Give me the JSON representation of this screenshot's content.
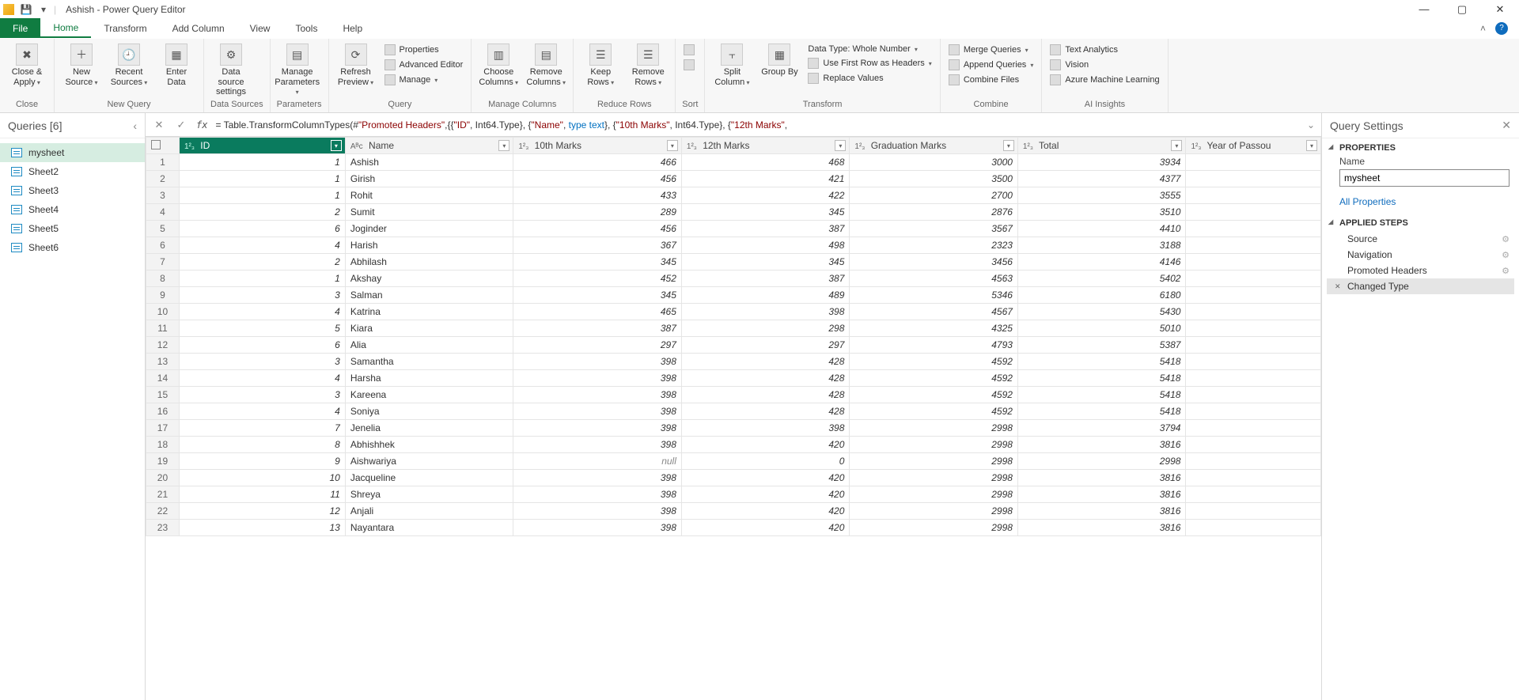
{
  "title": "Ashish - Power Query Editor",
  "menu": {
    "file": "File",
    "home": "Home",
    "transform": "Transform",
    "addcolumn": "Add Column",
    "view": "View",
    "tools": "Tools",
    "help": "Help"
  },
  "ribbon": {
    "close": {
      "closeapply": "Close &\nApply",
      "group": "Close"
    },
    "newquery": {
      "newsource": "New\nSource",
      "recentsources": "Recent\nSources",
      "enterdata": "Enter\nData",
      "group": "New Query"
    },
    "datasources": {
      "settings": "Data source\nsettings",
      "group": "Data Sources"
    },
    "parameters": {
      "manage": "Manage\nParameters",
      "group": "Parameters"
    },
    "query": {
      "refresh": "Refresh\nPreview",
      "properties": "Properties",
      "advanced": "Advanced Editor",
      "manage": "Manage",
      "group": "Query"
    },
    "managecols": {
      "choose": "Choose\nColumns",
      "remove": "Remove\nColumns",
      "group": "Manage Columns"
    },
    "reducerows": {
      "keep": "Keep\nRows",
      "remove": "Remove\nRows",
      "group": "Reduce Rows"
    },
    "sort": {
      "group": "Sort"
    },
    "transform": {
      "split": "Split\nColumn",
      "groupby": "Group\nBy",
      "datatype": "Data Type: Whole Number",
      "firstrow": "Use First Row as Headers",
      "replace": "Replace Values",
      "group": "Transform"
    },
    "combine": {
      "merge": "Merge Queries",
      "append": "Append Queries",
      "combinefiles": "Combine Files",
      "group": "Combine"
    },
    "ai": {
      "textanalytics": "Text Analytics",
      "vision": "Vision",
      "aml": "Azure Machine Learning",
      "group": "AI Insights"
    }
  },
  "queriesPane": {
    "title": "Queries [6]",
    "items": [
      "mysheet",
      "Sheet2",
      "Sheet3",
      "Sheet4",
      "Sheet5",
      "Sheet6"
    ],
    "selected": 0
  },
  "formula": {
    "prefix": "= Table.TransformColumnTypes(#",
    "s1": "\"Promoted Headers\"",
    "mid1": ",{{",
    "s2": "\"ID\"",
    "mid2": ", Int64.Type}, {",
    "s3": "\"Name\"",
    "mid3": ", ",
    "kw": "type text",
    "mid4": "}, {",
    "s4": "\"10th Marks\"",
    "mid5": ", Int64.Type}, {",
    "s5": "\"12th Marks\"",
    "mid6": ","
  },
  "columns": [
    {
      "name": "ID",
      "type": "123"
    },
    {
      "name": "Name",
      "type": "ABC"
    },
    {
      "name": "10th Marks",
      "type": "123"
    },
    {
      "name": "12th Marks",
      "type": "123"
    },
    {
      "name": "Graduation Marks",
      "type": "123"
    },
    {
      "name": "Total",
      "type": "123"
    },
    {
      "name": "Year of Passou",
      "type": "123"
    }
  ],
  "rows": [
    {
      "n": 1,
      "id": "1",
      "name": "Ashish",
      "m10": "466",
      "m12": "468",
      "grad": "3000",
      "total": "3934"
    },
    {
      "n": 2,
      "id": "1",
      "name": "Girish",
      "m10": "456",
      "m12": "421",
      "grad": "3500",
      "total": "4377"
    },
    {
      "n": 3,
      "id": "1",
      "name": "Rohit",
      "m10": "433",
      "m12": "422",
      "grad": "2700",
      "total": "3555"
    },
    {
      "n": 4,
      "id": "2",
      "name": "Sumit",
      "m10": "289",
      "m12": "345",
      "grad": "2876",
      "total": "3510"
    },
    {
      "n": 5,
      "id": "6",
      "name": "Joginder",
      "m10": "456",
      "m12": "387",
      "grad": "3567",
      "total": "4410"
    },
    {
      "n": 6,
      "id": "4",
      "name": "Harish",
      "m10": "367",
      "m12": "498",
      "grad": "2323",
      "total": "3188"
    },
    {
      "n": 7,
      "id": "2",
      "name": "Abhilash",
      "m10": "345",
      "m12": "345",
      "grad": "3456",
      "total": "4146"
    },
    {
      "n": 8,
      "id": "1",
      "name": "Akshay",
      "m10": "452",
      "m12": "387",
      "grad": "4563",
      "total": "5402"
    },
    {
      "n": 9,
      "id": "3",
      "name": "Salman",
      "m10": "345",
      "m12": "489",
      "grad": "5346",
      "total": "6180"
    },
    {
      "n": 10,
      "id": "4",
      "name": "Katrina",
      "m10": "465",
      "m12": "398",
      "grad": "4567",
      "total": "5430"
    },
    {
      "n": 11,
      "id": "5",
      "name": "Kiara",
      "m10": "387",
      "m12": "298",
      "grad": "4325",
      "total": "5010"
    },
    {
      "n": 12,
      "id": "6",
      "name": "Alia",
      "m10": "297",
      "m12": "297",
      "grad": "4793",
      "total": "5387"
    },
    {
      "n": 13,
      "id": "3",
      "name": "Samantha",
      "m10": "398",
      "m12": "428",
      "grad": "4592",
      "total": "5418"
    },
    {
      "n": 14,
      "id": "4",
      "name": "Harsha",
      "m10": "398",
      "m12": "428",
      "grad": "4592",
      "total": "5418"
    },
    {
      "n": 15,
      "id": "3",
      "name": "Kareena",
      "m10": "398",
      "m12": "428",
      "grad": "4592",
      "total": "5418"
    },
    {
      "n": 16,
      "id": "4",
      "name": "Soniya",
      "m10": "398",
      "m12": "428",
      "grad": "4592",
      "total": "5418"
    },
    {
      "n": 17,
      "id": "7",
      "name": "Jenelia",
      "m10": "398",
      "m12": "398",
      "grad": "2998",
      "total": "3794"
    },
    {
      "n": 18,
      "id": "8",
      "name": "Abhishhek",
      "m10": "398",
      "m12": "420",
      "grad": "2998",
      "total": "3816"
    },
    {
      "n": 19,
      "id": "9",
      "name": "Aishwariya",
      "m10": "null",
      "m12": "0",
      "grad": "2998",
      "total": "2998"
    },
    {
      "n": 20,
      "id": "10",
      "name": "Jacqueline",
      "m10": "398",
      "m12": "420",
      "grad": "2998",
      "total": "3816"
    },
    {
      "n": 21,
      "id": "11",
      "name": "Shreya",
      "m10": "398",
      "m12": "420",
      "grad": "2998",
      "total": "3816"
    },
    {
      "n": 22,
      "id": "12",
      "name": "Anjali",
      "m10": "398",
      "m12": "420",
      "grad": "2998",
      "total": "3816"
    },
    {
      "n": 23,
      "id": "13",
      "name": "Nayantara",
      "m10": "398",
      "m12": "420",
      "grad": "2998",
      "total": "3816"
    }
  ],
  "settings": {
    "title": "Query Settings",
    "properties": "PROPERTIES",
    "nameLabel": "Name",
    "nameValue": "mysheet",
    "allprops": "All Properties",
    "appliedsteps": "APPLIED STEPS",
    "steps": [
      "Source",
      "Navigation",
      "Promoted Headers",
      "Changed Type"
    ],
    "selectedStep": 3
  }
}
